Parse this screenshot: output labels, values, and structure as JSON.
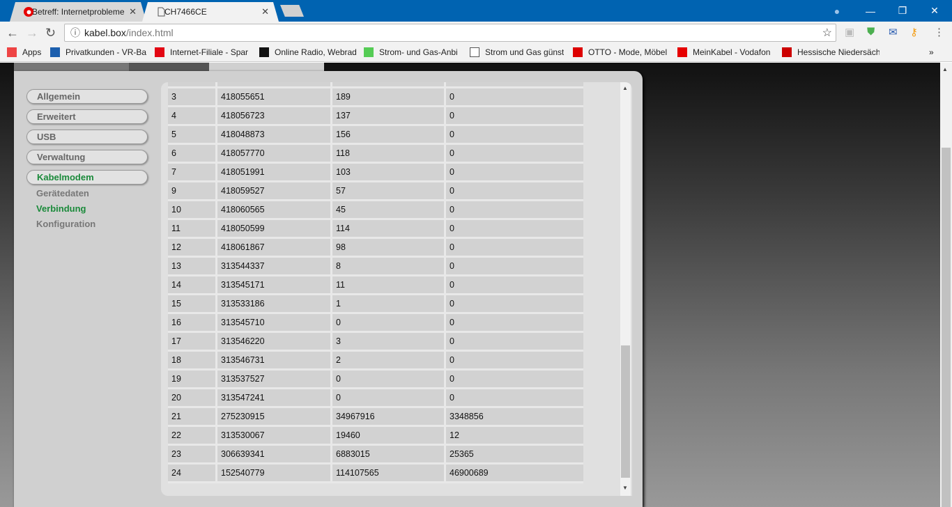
{
  "browser": {
    "tabs": [
      {
        "label": "Betreff: Internetprobleme",
        "icon": "vodafone-icon",
        "active": false
      },
      {
        "label": "CH7466CE",
        "icon": "page-icon",
        "active": true
      }
    ],
    "url_host": "kabel.box",
    "url_path": "/index.html",
    "bookmarks": [
      {
        "label": "Apps",
        "icon": "apps-grid-icon"
      },
      {
        "label": "Privatkunden - VR-Ba",
        "icon": "vr-bank-icon"
      },
      {
        "label": "Internet-Filiale - Spar",
        "icon": "sparkasse-icon"
      },
      {
        "label": "Online Radio, Webrad",
        "icon": "radio-icon"
      },
      {
        "label": "Strom- und Gas-Anbi",
        "icon": "energy-icon"
      },
      {
        "label": "Strom und Gas günst",
        "icon": "page-icon"
      },
      {
        "label": "OTTO - Mode, Möbel",
        "icon": "otto-icon"
      },
      {
        "label": "MeinKabel - Vodafon",
        "icon": "vodafone-icon"
      },
      {
        "label": "Hessische Niedersäch",
        "icon": "hna-icon"
      }
    ],
    "more_bookmarks": "»"
  },
  "sidebar": {
    "items": [
      {
        "label": "Allgemein",
        "selected": false
      },
      {
        "label": "Erweitert",
        "selected": false
      },
      {
        "label": "USB",
        "selected": false
      },
      {
        "label": "Verwaltung",
        "selected": false
      },
      {
        "label": "Kabelmodem",
        "selected": true
      }
    ],
    "subitems": [
      {
        "label": "Gerätedaten",
        "selected": false
      },
      {
        "label": "Verbindung",
        "selected": true
      },
      {
        "label": "Konfiguration",
        "selected": false
      }
    ]
  },
  "colors": {
    "accent_green": "#1a8a3a",
    "chrome_blue": "#0063b1"
  },
  "table": {
    "rows": [
      [
        "3",
        "418055651",
        "189",
        "0"
      ],
      [
        "4",
        "418056723",
        "137",
        "0"
      ],
      [
        "5",
        "418048873",
        "156",
        "0"
      ],
      [
        "6",
        "418057770",
        "118",
        "0"
      ],
      [
        "7",
        "418051991",
        "103",
        "0"
      ],
      [
        "9",
        "418059527",
        "57",
        "0"
      ],
      [
        "10",
        "418060565",
        "45",
        "0"
      ],
      [
        "11",
        "418050599",
        "114",
        "0"
      ],
      [
        "12",
        "418061867",
        "98",
        "0"
      ],
      [
        "13",
        "313544337",
        "8",
        "0"
      ],
      [
        "14",
        "313545171",
        "11",
        "0"
      ],
      [
        "15",
        "313533186",
        "1",
        "0"
      ],
      [
        "16",
        "313545710",
        "0",
        "0"
      ],
      [
        "17",
        "313546220",
        "3",
        "0"
      ],
      [
        "18",
        "313546731",
        "2",
        "0"
      ],
      [
        "19",
        "313537527",
        "0",
        "0"
      ],
      [
        "20",
        "313547241",
        "0",
        "0"
      ],
      [
        "21",
        "275230915",
        "34967916",
        "3348856"
      ],
      [
        "22",
        "313530067",
        "19460",
        "12"
      ],
      [
        "23",
        "306639341",
        "6883015",
        "25365"
      ],
      [
        "24",
        "152540779",
        "114107565",
        "46900689"
      ]
    ]
  }
}
